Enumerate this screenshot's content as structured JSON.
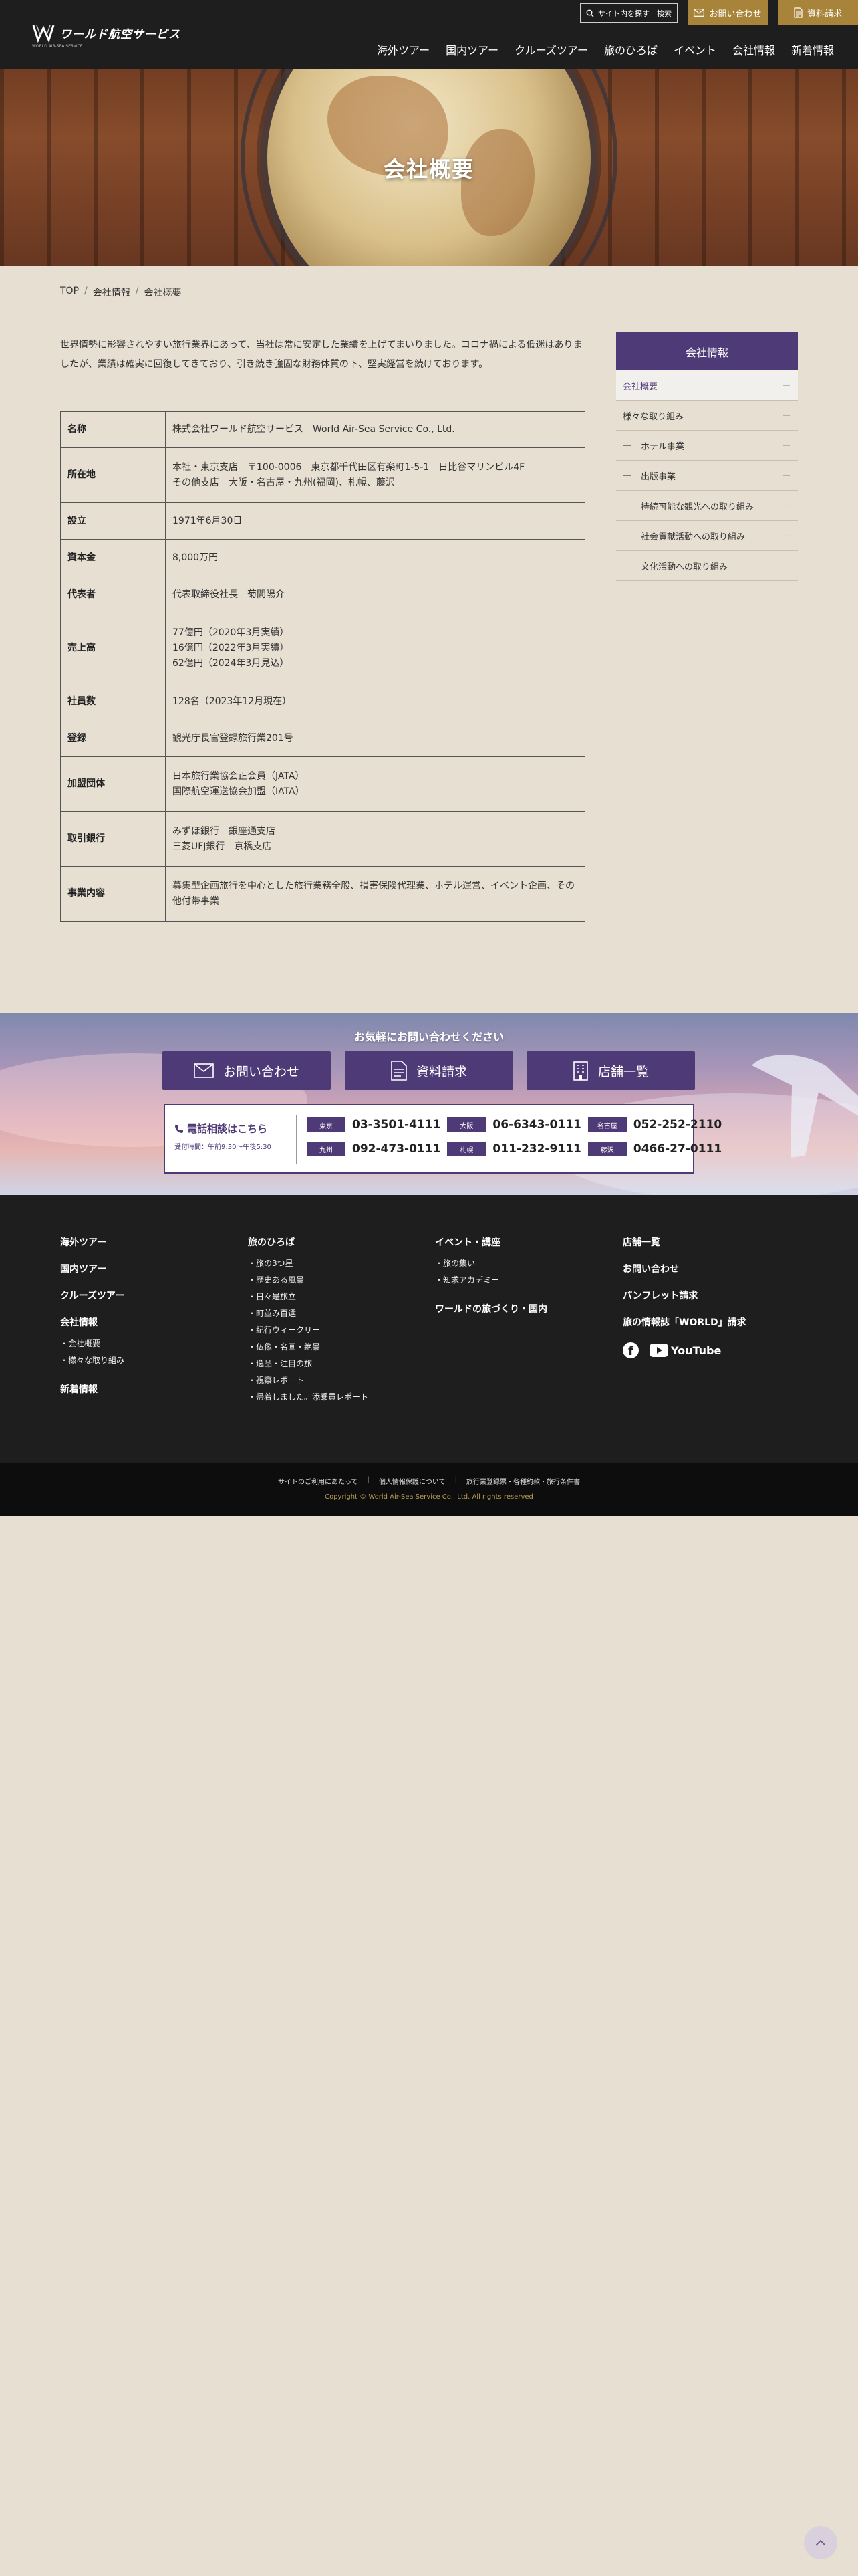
{
  "header": {
    "logo_text": "ワールド航空サービス",
    "logo_sub": "WORLD AIR-SEA SERVICE",
    "search_placeholder": "サイト内を探す",
    "search_button": "検索",
    "contact_label": "お問い合わせ",
    "docs_label": "資料請求",
    "nav": [
      "海外ツアー",
      "国内ツアー",
      "クルーズツアー",
      "旅のひろば",
      "イベント",
      "会社情報",
      "新着情報"
    ]
  },
  "hero": {
    "title": "会社概要"
  },
  "breadcrumb": [
    "TOP",
    "会社情報",
    "会社概要"
  ],
  "intro": "世界情勢に影響されやすい旅行業界にあって、当社は常に安定した業績を上げてまいりました。コロナ禍による低迷はありましたが、業績は確実に回復してきており、引き続き強固な財務体質の下、堅実経営を続けております。",
  "company_table": [
    {
      "key": "名称",
      "value": "株式会社ワールド航空サービス　World Air-Sea Service Co., Ltd."
    },
    {
      "key": "所在地",
      "value": "本社・東京支店　〒100-0006　東京都千代田区有楽町1-5-1　日比谷マリンビル4F\nその他支店　大阪・名古屋・九州(福岡)、札幌、藤沢"
    },
    {
      "key": "設立",
      "value": "1971年6月30日"
    },
    {
      "key": "資本金",
      "value": "8,000万円"
    },
    {
      "key": "代表者",
      "value": "代表取締役社長　菊間陽介"
    },
    {
      "key": "売上高",
      "value": "77億円（2020年3月実績）\n16億円（2022年3月実績）\n62億円（2024年3月見込）"
    },
    {
      "key": "社員数",
      "value": "128名（2023年12月現在）"
    },
    {
      "key": "登録",
      "value": "観光庁長官登録旅行業201号"
    },
    {
      "key": "加盟団体",
      "value": "日本旅行業協会正会員（JATA）\n国際航空運送協会加盟（IATA）"
    },
    {
      "key": "取引銀行",
      "value": "みずほ銀行　銀座通支店\n三菱UFJ銀行　京橋支店"
    },
    {
      "key": "事業内容",
      "value": "募集型企画旅行を中心とした旅行業務全般、損害保険代理業、ホテル運営、イベント企画、その他付帯事業"
    }
  ],
  "sidebar": {
    "title": "会社情報",
    "items": [
      {
        "label": "会社概要",
        "active": true,
        "sub": false
      },
      {
        "label": "様々な取り組み",
        "active": false,
        "sub": false
      },
      {
        "label": "ホテル事業",
        "active": false,
        "sub": true
      },
      {
        "label": "出版事業",
        "active": false,
        "sub": true
      },
      {
        "label": "持続可能な観光への取り組み",
        "active": false,
        "sub": true
      },
      {
        "label": "社会貢献活動への取り組み",
        "active": false,
        "sub": true
      },
      {
        "label": "文化活動への取り組み",
        "active": false,
        "sub": true
      }
    ]
  },
  "contact": {
    "title": "お気軽にお問い合わせください",
    "buttons": [
      "お問い合わせ",
      "資料請求",
      "店舗一覧"
    ],
    "phone_title": "電話相談はこちら",
    "phone_hours": "受付時間：午前9:30〜午後5:30",
    "phones": [
      {
        "city": "東京",
        "number": "03-3501-4111"
      },
      {
        "city": "大阪",
        "number": "06-6343-0111"
      },
      {
        "city": "名古屋",
        "number": "052-252-2110"
      },
      {
        "city": "九州",
        "number": "092-473-0111"
      },
      {
        "city": "札幌",
        "number": "011-232-9111"
      },
      {
        "city": "藤沢",
        "number": "0466-27-0111"
      }
    ]
  },
  "footer": {
    "col1": {
      "links": [
        "海外ツアー",
        "国内ツアー",
        "クルーズツアー"
      ],
      "company": "会社情報",
      "company_sub": [
        "会社概要",
        "様々な取り組み"
      ],
      "news": "新着情報"
    },
    "col2": {
      "head": "旅のひろば",
      "sub": [
        "旅の3つ星",
        "歴史ある風景",
        "日々是旅立",
        "町並み百選",
        "紀行ウィークリー",
        "仏像・名画・絶景",
        "逸品・注目の旅",
        "視察レポート",
        "帰着しました。添乗員レポート"
      ]
    },
    "col3": {
      "head": "イベント・講座",
      "sub": [
        "旅の集い",
        "知求アカデミー"
      ],
      "head2": "ワールドの旅づくり・国内"
    },
    "col4": {
      "links": [
        "店舗一覧",
        "お問い合わせ",
        "パンフレット請求",
        "旅の情報誌「WORLD」請求"
      ],
      "youtube": "YouTube"
    },
    "legal": [
      "サイトのご利用にあたって",
      "個人情報保護について",
      "旅行業登録票・各種約款・旅行条件書"
    ],
    "copyright": "Copyright © World Air-Sea Service Co., Ltd. All rights reserved"
  }
}
